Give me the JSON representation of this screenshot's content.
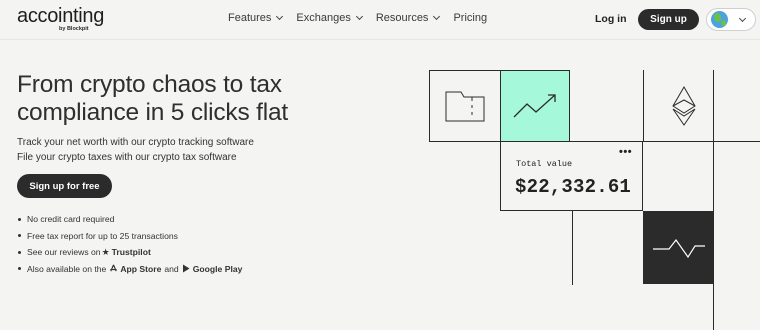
{
  "header": {
    "logo": "accointing",
    "logo_sub": "by Blockpit",
    "nav": [
      {
        "label": "Features",
        "has_dropdown": true
      },
      {
        "label": "Exchanges",
        "has_dropdown": true
      },
      {
        "label": "Resources",
        "has_dropdown": true
      },
      {
        "label": "Pricing",
        "has_dropdown": false
      }
    ],
    "login_label": "Log in",
    "signup_label": "Sign up",
    "language_icon": "globe-icon"
  },
  "hero": {
    "title_line1": "From crypto chaos to tax",
    "title_line2": "compliance in 5 clicks flat",
    "sub1": "Track your net worth with our crypto tracking software",
    "sub2": "File your crypto taxes with our crypto tax software",
    "cta_label": "Sign up for free",
    "bullets": {
      "b1": "No credit card required",
      "b2": "Free tax report for up to 25 transactions",
      "b3_prefix": "See our reviews on",
      "b3_brand": "Trustpilot",
      "b4_prefix": "Also available on the",
      "b4_app": "App Store",
      "b4_and": "and",
      "b4_play": "Google Play"
    }
  },
  "illustration": {
    "card_label": "Total value",
    "card_value": "$22,332.61",
    "accent_green": "#a6f8db",
    "dark": "#2b2b2b",
    "icons": [
      "folder-icon",
      "trend-up-icon",
      "ethereum-icon",
      "more-icon",
      "pulse-icon"
    ]
  }
}
